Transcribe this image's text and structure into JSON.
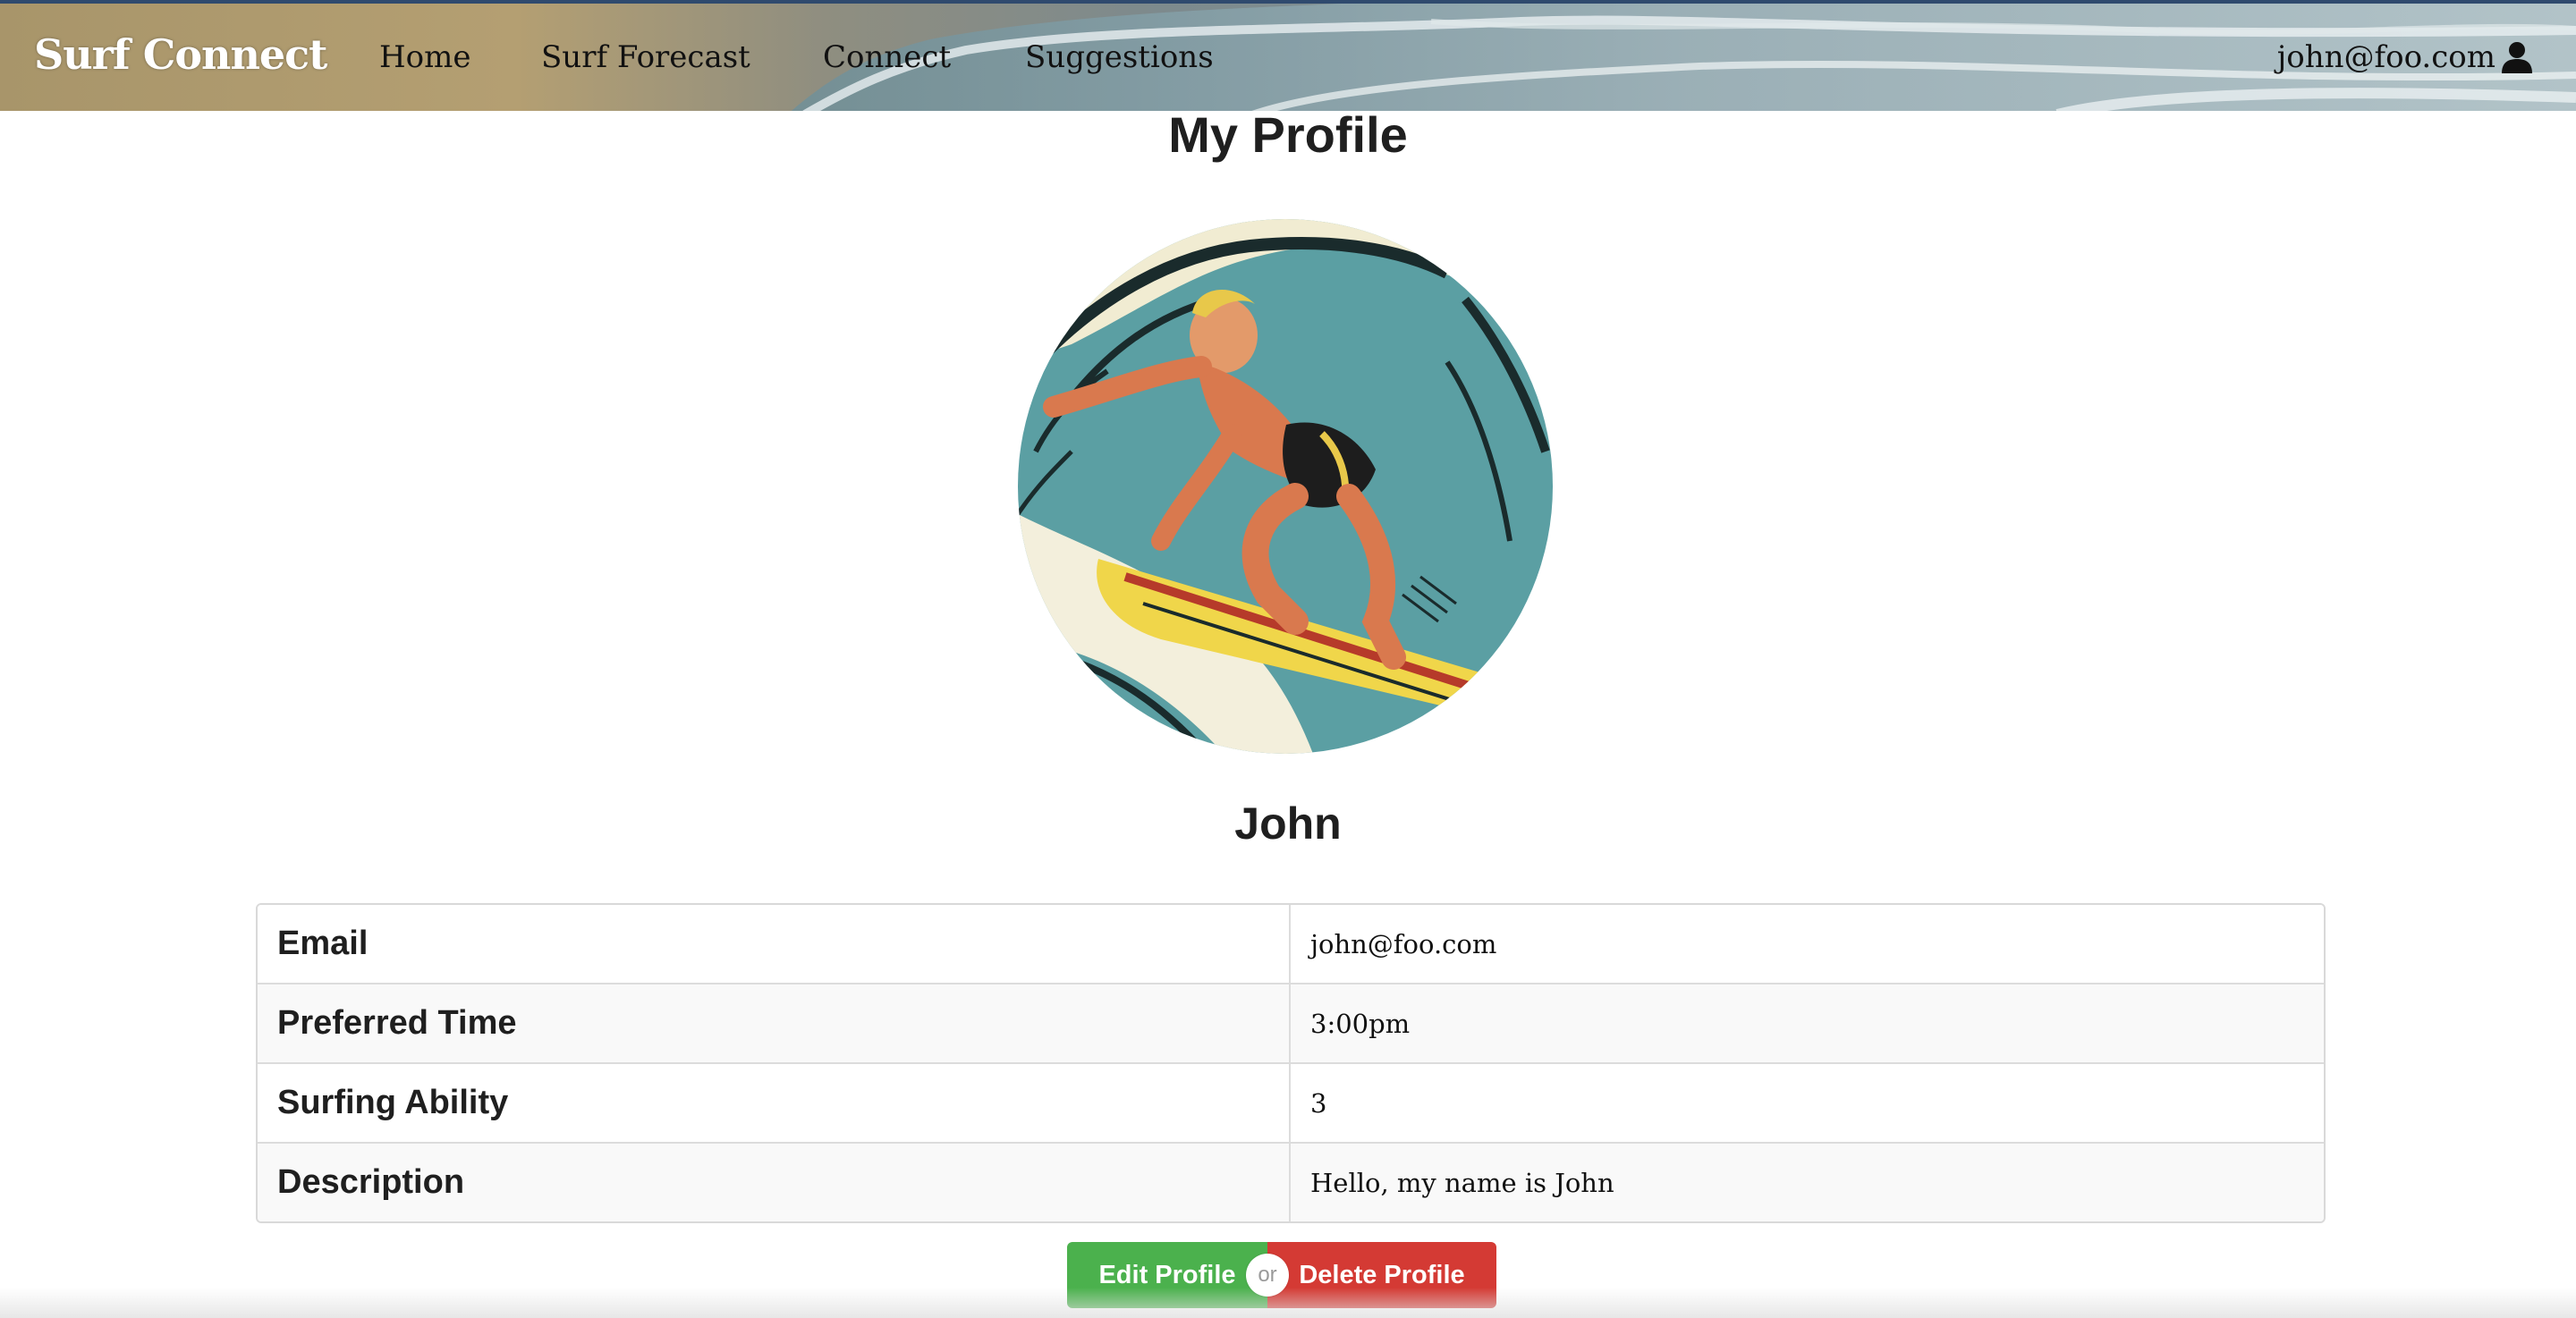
{
  "navbar": {
    "brand": "Surf Connect",
    "items": [
      {
        "label": "Home"
      },
      {
        "label": "Surf Forecast"
      },
      {
        "label": "Connect"
      },
      {
        "label": "Suggestions"
      }
    ],
    "user": "john@foo.com",
    "user_icon": "user-icon"
  },
  "main": {
    "title": "My Profile",
    "avatar_icon": "surfer-illustration",
    "name": "John",
    "fields": [
      {
        "label": "Email",
        "value": "john@foo.com"
      },
      {
        "label": "Preferred Time",
        "value": "3:00pm"
      },
      {
        "label": "Surfing Ability",
        "value": "3"
      },
      {
        "label": "Description",
        "value": "Hello, my name is John"
      }
    ],
    "actions": {
      "edit": "Edit Profile",
      "or": "or",
      "delete": "Delete Profile"
    }
  },
  "colors": {
    "edit": "#4bb14d",
    "delete": "#d43a34",
    "nav_border": "#2f4a6e"
  }
}
